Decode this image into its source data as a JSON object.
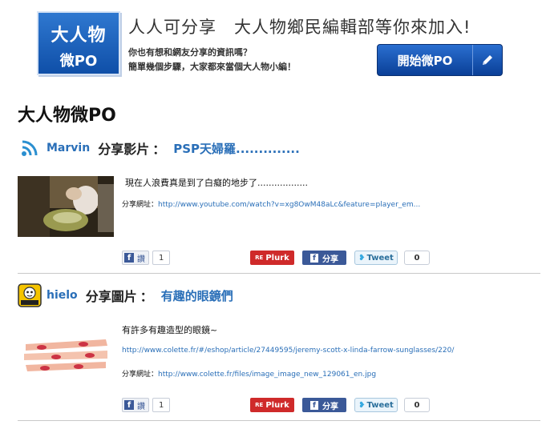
{
  "banner": {
    "logo_line1": "大人物",
    "logo_line2": "微PO",
    "title": "人人可分享　大人物鄉民編輯部等你來加入!",
    "subtitle1": "你也有想和網友分享的資訊嗎？",
    "subtitle2": "簡單幾個步驟，大家都來當個大人物小編！",
    "start_button_label": "開始微PO",
    "start_button_icon": "pencil-icon"
  },
  "section": {
    "title": "大人物微PO"
  },
  "posts": [
    {
      "avatar_icon": "broadcast-icon",
      "user": "Marvin",
      "verb": "分享影片",
      "colon": "：",
      "title": "PSP天婦羅..............",
      "text": "現在人浪費真是到了白癡的地步了..................",
      "share_label": "分享網址：",
      "share_url": "http://www.youtube.com/watch?v=xg8OwM48aLc&feature=player_em...",
      "like_label": "讚",
      "like_count": "1",
      "plurk_re": "RE",
      "plurk_label": "Plurk",
      "fb_share_label": "分享",
      "tweet_label": "Tweet",
      "tweet_count": "0"
    },
    {
      "avatar_icon": "avatar-badge-icon",
      "user": "hielo",
      "verb": "分享圖片",
      "colon": "：",
      "title": "有趣的眼鏡們",
      "text": "有許多有趣造型的眼鏡~",
      "link": "http://www.colette.fr/#/eshop/article/27449595/jeremy-scott-x-linda-farrow-sunglasses/220/",
      "share_label": "分享網址：",
      "share_url": "http://www.colette.fr/files/image_image_new_129061_en.jpg",
      "like_label": "讚",
      "like_count": "1",
      "plurk_re": "RE",
      "plurk_label": "Plurk",
      "fb_share_label": "分享",
      "tweet_label": "Tweet",
      "tweet_count": "0"
    }
  ],
  "colors": {
    "brand_blue": "#0f4fa8",
    "link_blue": "#2a6fb8",
    "plurk_red": "#cf2a2a",
    "facebook_blue": "#3b5998"
  }
}
